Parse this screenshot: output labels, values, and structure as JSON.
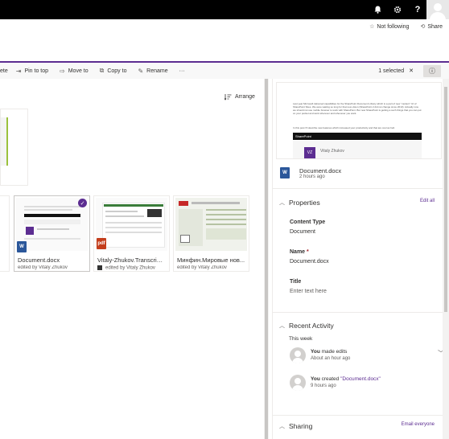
{
  "topbar": {
    "bell_icon": "bell-icon",
    "gear_icon": "gear-icon",
    "help_label": "?"
  },
  "follow": {
    "not_following": "Not following",
    "share": "Share"
  },
  "commandbar": {
    "partial_label": "ete",
    "pin_to_top": "Pin to top",
    "move_to": "Move to",
    "copy_to": "Copy to",
    "rename": "Rename",
    "more": "···",
    "selected": "1 selected",
    "close": "✕",
    "info": "ⓘ"
  },
  "arrange": "Arrange",
  "files": [
    {
      "name": "Document.docx",
      "meta": "edited by Vitaly Zhukov",
      "type": "word",
      "selected": true
    },
    {
      "name": "Vitaly-Zhukov.Transcript.pdf",
      "meta": "edited by Vitaly Zhukov",
      "type": "pdf",
      "selected": false
    },
    {
      "name": "Минфин.Мировые нов...",
      "meta": "edited by Vitaly Zhukov",
      "type": "image",
      "selected": false
    }
  ],
  "pane": {
    "preview_text_1": "Last year Microsoft delivered capabilities for the SharePoint Document Library which is a part of new “modern” UI of SharePoint Sites. We were waiting so long for that new vision (SharePoint 2 did not change since 2013). Actually now we should not use mobile browser to work with SharePoint. But now SharePoint is getting a such things that you can put on your pocket and work wherever and whenever you want.",
    "preview_text_2": "In this post I'll describe new features which increased your productivity and that are cool as hell.",
    "preview_banner": "SharePoint",
    "preview_author": "Vitaly Zhukov",
    "preview_initials": "VZ",
    "doc_name": "Document.docx",
    "doc_time": "2 hours ago",
    "properties": {
      "title": "Properties",
      "edit_all": "Edit all",
      "content_type_label": "Content Type",
      "content_type_value": "Document",
      "name_label": "Name",
      "name_required": "*",
      "name_value": "Document.docx",
      "title_label": "Title",
      "title_placeholder": "Enter text here"
    },
    "activity": {
      "title": "Recent Activity",
      "week": "This week",
      "items": [
        {
          "actor": "You",
          "action": " made edits",
          "target": "",
          "time": "About an hour ago"
        },
        {
          "actor": "You",
          "action": " created ",
          "target": "\"Document.docx\"",
          "time": "9 hours ago"
        }
      ]
    },
    "sharing": {
      "title": "Sharing",
      "email_everyone": "Email everyone"
    }
  },
  "colors": {
    "accent": "#5c2d91",
    "topbar": "#000000",
    "word": "#2b579a",
    "pdf": "#c43e1c"
  }
}
